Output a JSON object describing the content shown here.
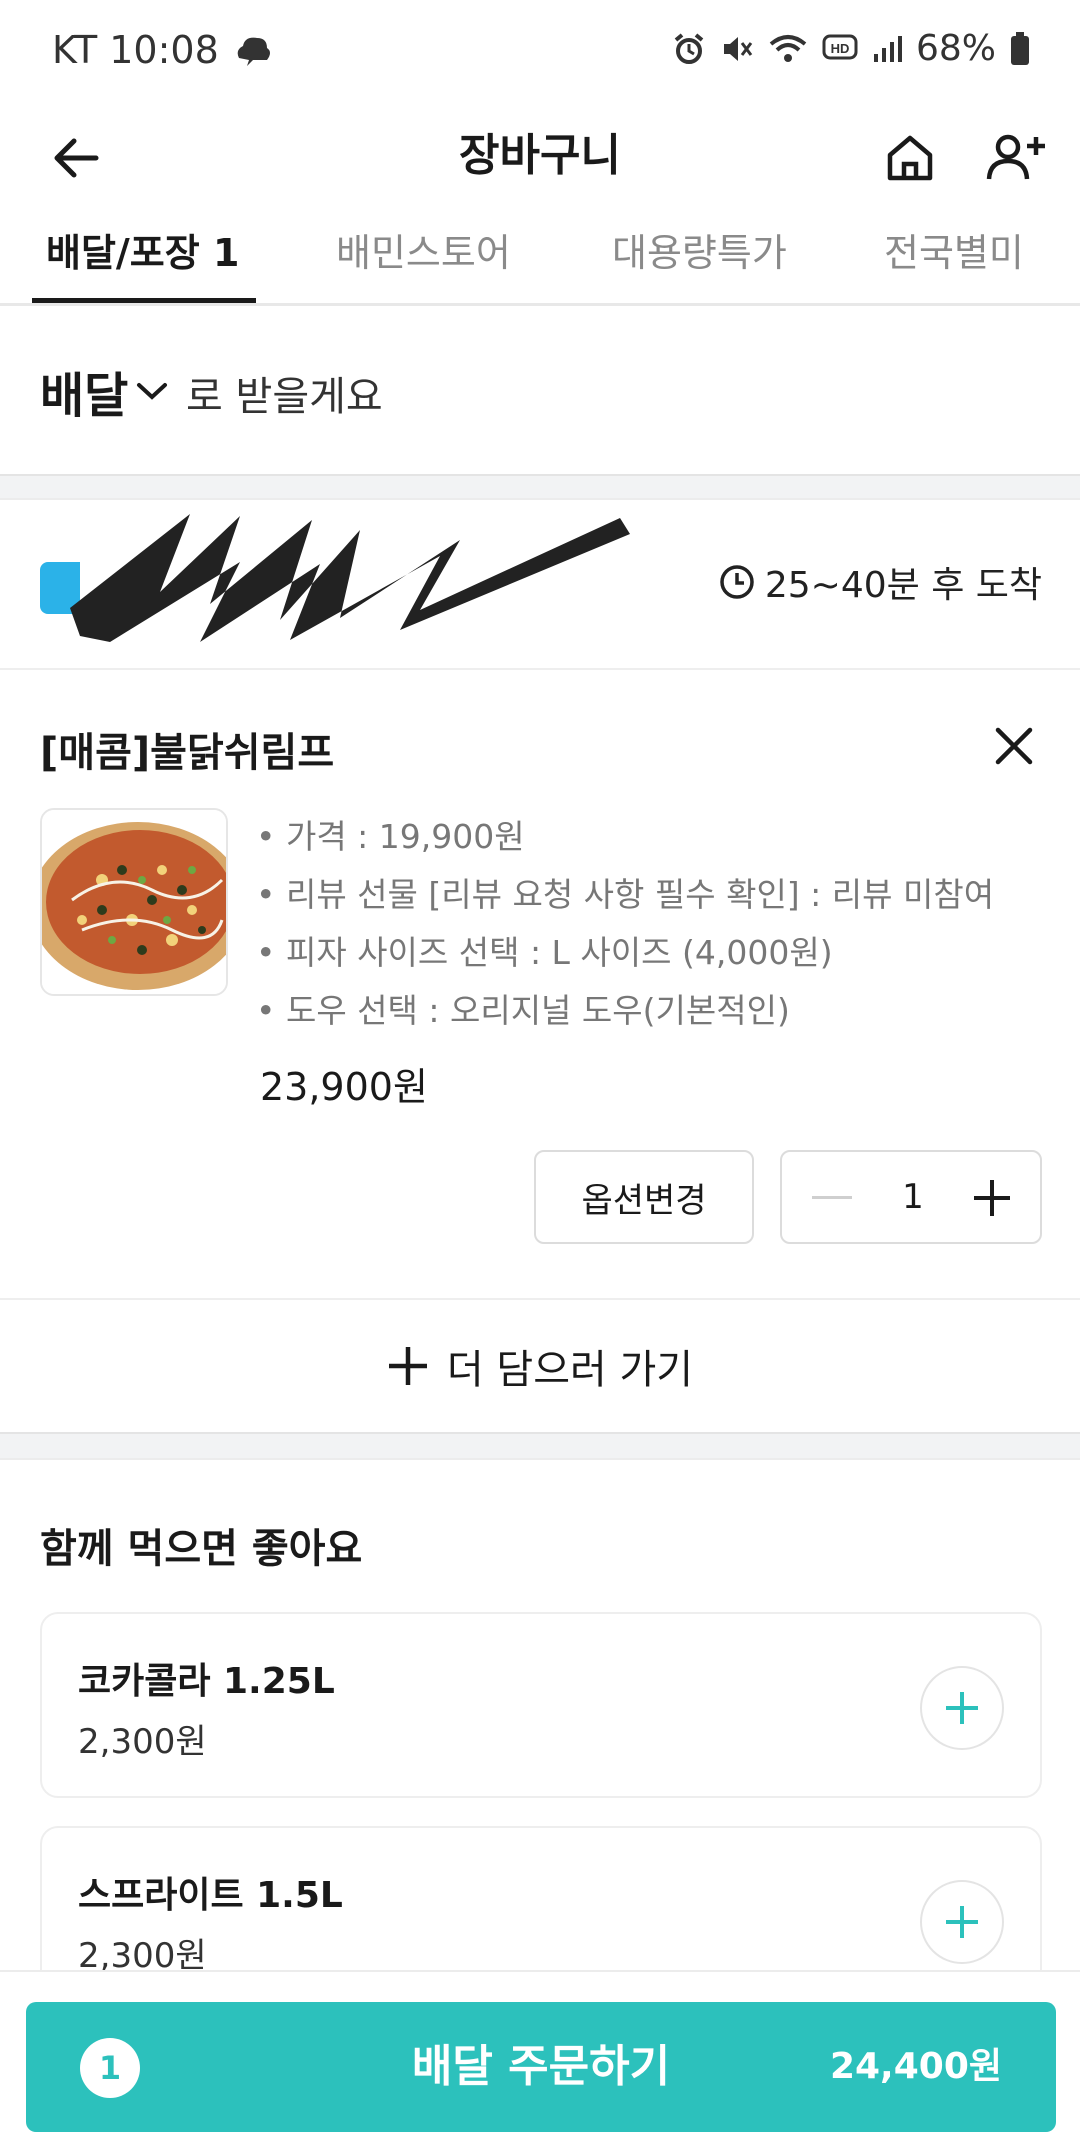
{
  "status_bar": {
    "carrier_time": "KT 10:08",
    "battery": "68%"
  },
  "header": {
    "title": "장바구니",
    "icons": [
      "back-arrow-icon",
      "home-icon",
      "add-user-icon"
    ]
  },
  "tabs": [
    {
      "label": "배달/포장 1",
      "active": true
    },
    {
      "label": "배민스토어",
      "active": false
    },
    {
      "label": "대용량특가",
      "active": false
    },
    {
      "label": "전국별미",
      "active": false
    }
  ],
  "delivery": {
    "mode": "배달",
    "suffix": "로 받을게요"
  },
  "store": {
    "eta": "25~40분 후 도착"
  },
  "cart_item": {
    "name": "[매콤]불닭쉬림프",
    "options": [
      "• 가격 : 19,900원",
      "• 리뷰 선물 [리뷰 요청 사항 필수 확인] : 리뷰 미참여",
      "• 피자 사이즈 선택 : L 사이즈 (4,000원)",
      "• 도우 선택 : 오리지널 도우(기본적인)"
    ],
    "price": "23,900원",
    "option_change_label": "옵션변경",
    "quantity": "1"
  },
  "add_more": {
    "label": "더 담으러 가기"
  },
  "recommend": {
    "title": "함께 먹으면 좋아요",
    "items": [
      {
        "name": "코카콜라 1.25L",
        "price": "2,300원"
      },
      {
        "name": "스프라이트 1.5L",
        "price": "2,300원"
      }
    ]
  },
  "order": {
    "count": "1",
    "label": "배달 주문하기",
    "total": "24,400원"
  },
  "colors": {
    "accent": "#2cc1bc",
    "store_logo": "#2bb2e8"
  }
}
